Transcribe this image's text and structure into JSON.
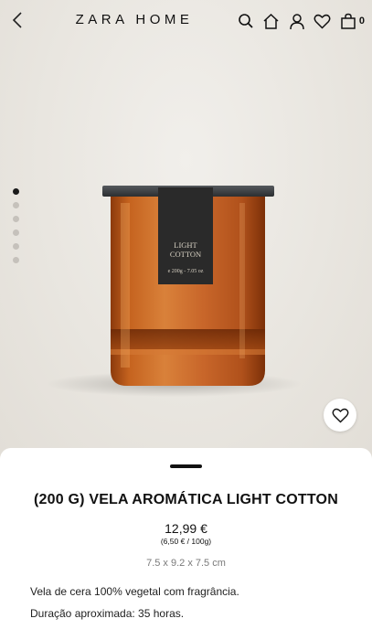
{
  "header": {
    "brand": "ZARA HOME",
    "bag_count": "0"
  },
  "gallery": {
    "image_count": 6,
    "active_index": 0,
    "label_line1": "LIGHT",
    "label_line2": "COTTON",
    "label_line3": "e 200g - 7.05 oz"
  },
  "product": {
    "title": "(200 G) VELA AROMÁTICA LIGHT COTTON",
    "price": "12,99 €",
    "unit_price": "(6,50 € / 100g)",
    "dimensions": "7.5 x 9.2 x 7.5 cm",
    "description_line1": "Vela de cera 100% vegetal com fragrância.",
    "description_line2": "Duração aproximada: 35 horas."
  },
  "colors": {
    "glass": "#b5541a",
    "lid": "#3a3d40",
    "label": "#2a2a2a"
  }
}
